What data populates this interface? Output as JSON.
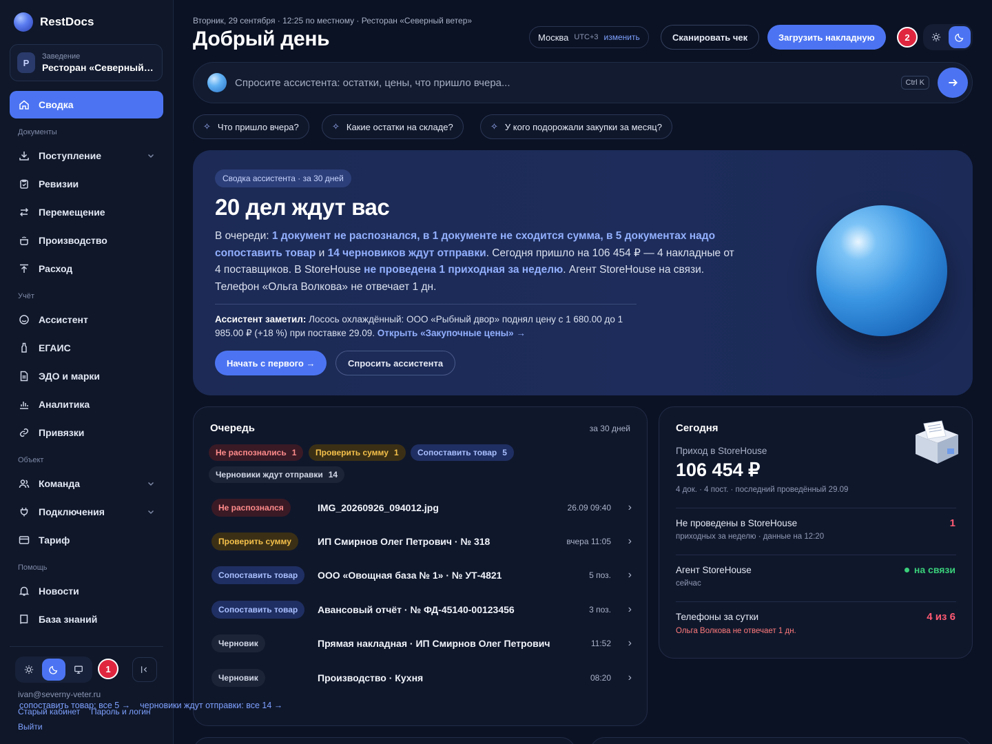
{
  "brand": {
    "name": "RestDocs"
  },
  "venue": {
    "caption": "Заведение",
    "avatar": "Р",
    "name": "Ресторан «Северный ветер»"
  },
  "nav": {
    "active": "Сводка",
    "sections": {
      "documents": "Документы",
      "accounting": "Учёт",
      "object": "Объект",
      "help": "Помощь"
    },
    "documents": [
      "Поступление",
      "Ревизии",
      "Перемещение",
      "Производство",
      "Расход"
    ],
    "accounting": [
      "Ассистент",
      "ЕГАИС",
      "ЭДО и марки",
      "Аналитика",
      "Привязки"
    ],
    "object": [
      "Команда",
      "Подключения",
      "Тариф"
    ],
    "help": [
      "Новости",
      "База знаний"
    ]
  },
  "sidebar_footer": {
    "badge": "1",
    "email": "ivan@severny-veter.ru",
    "old_cabinet": "Старый кабинет",
    "password": "Пароль и логин",
    "logout": "Выйти"
  },
  "header": {
    "meta": "Вторник, 29 сентября · 12:25 по местному · Ресторан «Северный ветер»",
    "title": "Добрый день",
    "city": "Москва",
    "utc": "UTC+3",
    "change": "изменить",
    "scan_button": "Сканировать чек",
    "upload_button": "Загрузить накладную",
    "badge": "2"
  },
  "search": {
    "placeholder": "Спросите ассистента: остатки, цены, что пришло вчера...",
    "shortcut": "Ctrl K"
  },
  "chips": [
    "Что пришло вчера?",
    "Какие остатки на складе?",
    "У кого подорожали закупки за месяц?"
  ],
  "hero": {
    "tag": "Сводка ассистента · за 30 дней",
    "title": "20 дел ждут вас",
    "p1": "В очереди: ",
    "h1": "1 документ не распознался, в 1 документе не сходится сумма, в 5 документах надо сопоставить товар",
    "p2": " и ",
    "h2": "14 черновиков ждут отправки",
    "p3": ". Сегодня пришло на 106 454 ₽ — 4 накладные от 4 поставщиков. В StoreHouse ",
    "h3": "не проведена 1 приходная за неделю",
    "p4": ". Агент StoreHouse на связи. Телефон «Ольга Волкова» не отвечает 1 дн.",
    "note_label": "Ассистент заметил:",
    "note_text": " Лосось охлаждённый: ООО «Рыбный двор» поднял цену с 1 680.00 до 1 985.00 ₽ (+18 %) при поставке 29.09. ",
    "note_link": "Открыть «Закупочные цены» →",
    "btn_start": "Начать с первого →",
    "btn_ask": "Спросить ассистента"
  },
  "queue": {
    "title": "Очередь",
    "period": "за 30 дней",
    "tags": [
      {
        "label": "Не распознались",
        "count": "1"
      },
      {
        "label": "Проверить сумму",
        "count": "1"
      },
      {
        "label": "Сопоставить товар",
        "count": "5"
      },
      {
        "label": "Черновики ждут отправки",
        "count": "14"
      }
    ],
    "rows": [
      {
        "status": "Не распознался",
        "name": "IMG_20260926_094012.jpg",
        "time": "26.09 09:40"
      },
      {
        "status": "Проверить сумму",
        "name": "ИП Смирнов Олег Петрович · № 318",
        "time": "вчера 11:05"
      },
      {
        "status": "Сопоставить товар",
        "name": "ООО «Овощная база № 1» · № УТ-4821",
        "time": "5 поз."
      },
      {
        "status": "Сопоставить товар",
        "name": "Авансовый отчёт · № ФД-45140-00123456",
        "time": "3 поз."
      },
      {
        "status": "Черновик",
        "name": "Прямая накладная · ИП Смирнов Олег Петрович",
        "time": "11:52"
      },
      {
        "status": "Черновик",
        "name": "Производство · Кухня",
        "time": "08:20"
      }
    ],
    "link_match": "сопоставить товар: все 5 →",
    "link_drafts": "черновики ждут отправки: все 14 →"
  },
  "today": {
    "title": "Сегодня",
    "income_label": "Приход в StoreHouse",
    "income_value": "106 454 ₽",
    "income_sub": "4 док. · 4 пост. · последний проведённый 29.09",
    "unposted_label": "Не проведены в StoreHouse",
    "unposted_sub": "приходных за неделю · данные на 12:20",
    "unposted_value": "1",
    "agent_label": "Агент StoreHouse",
    "agent_sub": "сейчас",
    "agent_status": "на связи",
    "phones_label": "Телефоны за сутки",
    "phones_sub": "Ольга Волкова не отвечает 1 дн.",
    "phones_value": "4 из 6"
  },
  "colors": {
    "accent": "#4c74f2",
    "danger": "#e0263f",
    "ok": "#3ad07a"
  }
}
